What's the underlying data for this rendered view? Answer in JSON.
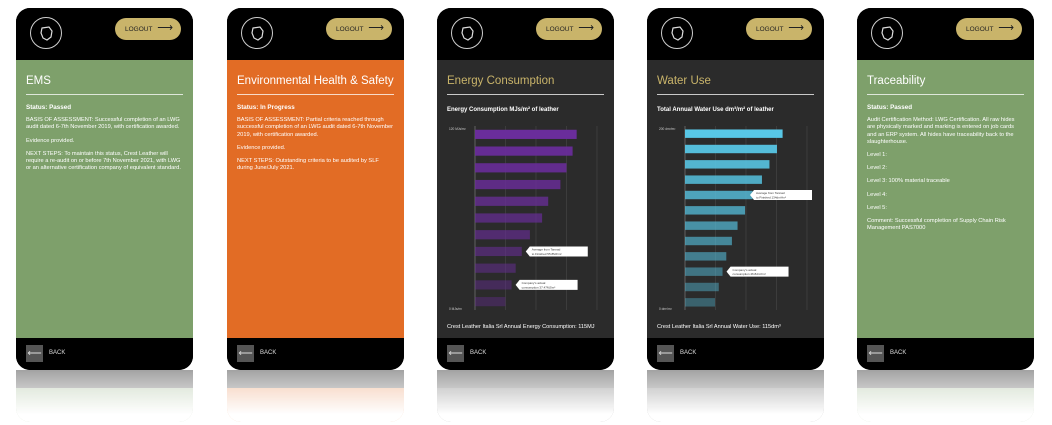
{
  "common": {
    "logout_label": "LOGOUT",
    "back_label": "BACK"
  },
  "colors": {
    "ems_bg": "#7ea06b",
    "ehs_bg": "#e26c25",
    "dark_bg": "#2b2b2b",
    "gold": "#c9b46a",
    "energy_bar": "#6a2d9b",
    "water_bar": "#58c7e6"
  },
  "ems": {
    "title": "EMS",
    "status": "Status: Passed",
    "p1": "BASIS OF ASSESSMENT: Successful completion of an LWG audit dated 6-7th November 2019, with certification awarded.",
    "p2": "Evidence provided.",
    "p3": "NEXT STEPS: To maintain this status, Crest Leather will require a re-audit on or before 7th November 2021, with LWG or an alternative certification company of equivalent standard."
  },
  "ehs": {
    "title": "Environmental Health & Safety",
    "status": "Status: In Progress",
    "p1": "BASIS OF ASSESSMENT: Partial criteria reached through successful completion of an LWG audit dated 6-7th November 2019, with certification awarded.",
    "p2": "Evidence provided.",
    "p3": "NEXT STEPS: Outstanding criteria to be audited by SLF during June/July 2021."
  },
  "energy": {
    "title": "Energy Consumption",
    "chart_title": "Energy Consumption MJs/m² of leather",
    "footer": "Crest Leather Italia Srl Annual Energy Consumption: 115MJ"
  },
  "water": {
    "title": "Water Use",
    "chart_title": "Total Annual Water Use dm³/m² of leather",
    "footer": "Crest Leather Italia Srl Annual Water Use: 115dm³"
  },
  "trace": {
    "title": "Traceability",
    "status": "Status: Passed",
    "p1": "Audit Certification Method: LWG Certification. All raw hides are physically marked and marking is entered on job cards and an ERP system. All hides have traceability back to the slaughterhouse.",
    "l1": "Level 1:",
    "l2": "Level 2:",
    "l3": "Level 3: 100% material traceable",
    "l4": "Level 4:",
    "l5": "Level 5:",
    "comment": "Comment: Successful completion of Supply Chain Risk Management PAS7000"
  },
  "chart_data": [
    {
      "type": "bar",
      "orientation": "horizontal",
      "title": "Energy Consumption MJs/m² of leather",
      "y_tick_labels": [
        "120 MJs/m²",
        "0 MJs/m²"
      ],
      "values": [
        100,
        96,
        90,
        84,
        72,
        66,
        54,
        46,
        40,
        36,
        30
      ],
      "xlim": [
        0,
        120
      ],
      "annotations": [
        {
          "text": "Average from Tannad to Finished 55.8MJ/m²",
          "bar_index": 7
        },
        {
          "text": "Company's actual consumption 37.47MJ/m²",
          "bar_index": 9
        }
      ],
      "grid": true
    },
    {
      "type": "bar",
      "orientation": "horizontal",
      "title": "Total Annual Water Use dm³/m² of leather",
      "y_tick_labels": [
        "200 dm³/m²",
        "0 dm³/m²"
      ],
      "values": [
        104,
        98,
        90,
        82,
        72,
        64,
        56,
        50,
        44,
        40,
        36,
        32
      ],
      "xlim": [
        0,
        130
      ],
      "annotations": [
        {
          "text": "Average from Tannad to Finished 134dm³/m²",
          "bar_index": 4
        },
        {
          "text": "Company's actual consumption 46.8dm³/m²",
          "bar_index": 9
        }
      ],
      "grid": true
    }
  ]
}
